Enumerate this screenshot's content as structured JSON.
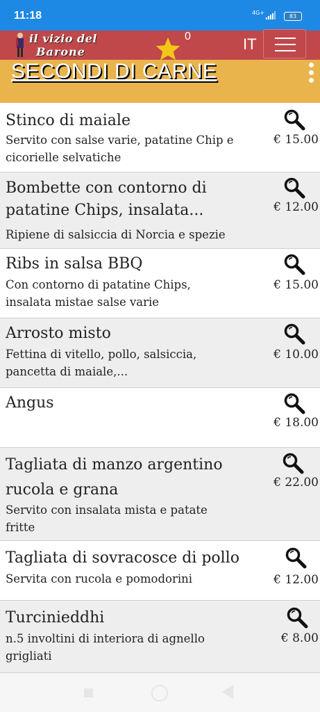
{
  "status_bar": {
    "time": "11:18",
    "network": "4G+",
    "battery": "83"
  },
  "header": {
    "logo_line1": "il vizio del",
    "logo_line2": "Barone",
    "favorites_count": "0",
    "language": "IT",
    "colors": {
      "appbar": "#c0484b",
      "statusbar": "#1e88e5",
      "section": "#e9b44c",
      "star": "#f5c518"
    }
  },
  "section": {
    "title": "SECONDI DI CARNE"
  },
  "menu_items": [
    {
      "name_lines": [
        "Stinco di maiale"
      ],
      "desc_lines": [
        "Servito con salse varie, patatine Chip e",
        "cicorielle selvatiche"
      ],
      "price": "€ 15.00"
    },
    {
      "name_lines": [
        "Bombette con contorno di",
        "patatine Chips, insalata..."
      ],
      "desc_lines": [
        "Ripiene di salsiccia di Norcia e spezie"
      ],
      "price": "€ 12.00"
    },
    {
      "name_lines": [
        "Ribs in salsa BBQ"
      ],
      "desc_lines": [
        "Con contorno di patatine Chips,",
        "insalata mistae salse varie"
      ],
      "price": "€ 15.00"
    },
    {
      "name_lines": [
        "Arrosto misto"
      ],
      "desc_lines": [
        "Fettina di vitello, pollo, salsiccia,",
        "pancetta di maiale,..."
      ],
      "price": "€ 10.00"
    },
    {
      "name_lines": [
        "Angus"
      ],
      "desc_lines": [],
      "price": "€ 18.00"
    },
    {
      "name_lines": [
        "Tagliata di manzo argentino",
        "rucola e grana"
      ],
      "desc_lines": [
        "Servito con insalata mista e patate",
        "fritte"
      ],
      "price": "€ 22.00"
    },
    {
      "name_lines": [
        "Tagliata di sovracosce di pollo"
      ],
      "desc_lines": [
        "Servita con rucola e pomodorini"
      ],
      "price": "€ 12.00"
    },
    {
      "name_lines": [
        "Turcinieddhi"
      ],
      "desc_lines": [
        "n.5 involtini di interiora di agnello",
        "grigliati"
      ],
      "price": "€ 8.00"
    }
  ],
  "icons": {
    "item_action": "magnifier-icon",
    "favorites": "star-icon",
    "menu": "hamburger-icon",
    "overflow": "more-vert-icon"
  }
}
